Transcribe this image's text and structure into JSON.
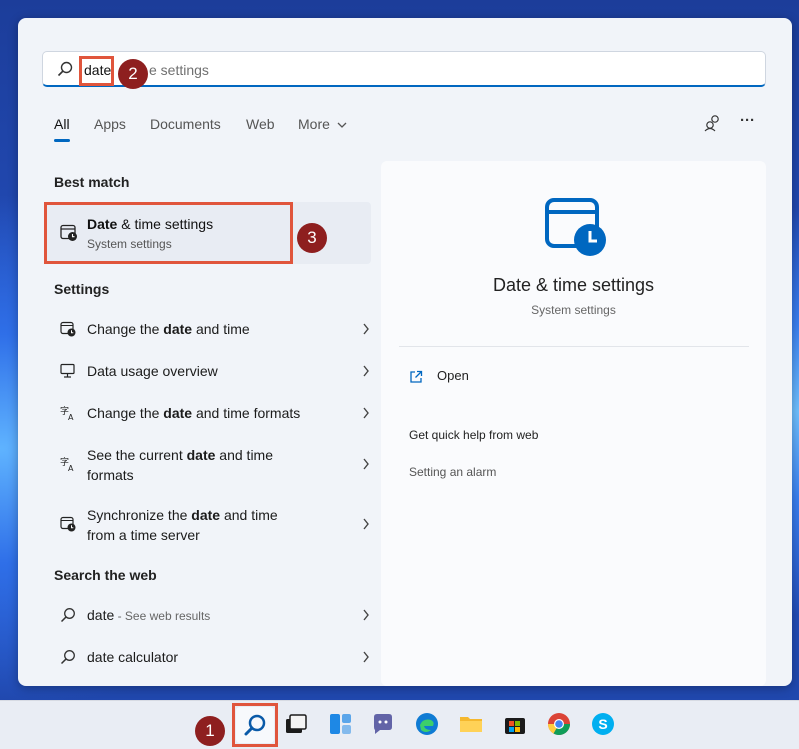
{
  "search": {
    "typed": "date",
    "placeholder_rest": "e settings"
  },
  "callouts": [
    "1",
    "2",
    "3"
  ],
  "tabs": [
    {
      "label": "All"
    },
    {
      "label": "Apps"
    },
    {
      "label": "Documents"
    },
    {
      "label": "Web"
    },
    {
      "label": "More"
    }
  ],
  "toolbar": {
    "more_options": "···"
  },
  "best_match": {
    "header": "Best match",
    "title_bold": "Date",
    "title_rest": " & time settings",
    "subtitle": "System settings"
  },
  "settings": {
    "header": "Settings",
    "items": [
      {
        "pre": "Change the ",
        "bold": "date",
        "post": " and time",
        "icon": "clock-calendar-icon"
      },
      {
        "pre": "Data usage overview",
        "bold": "",
        "post": "",
        "icon": "monitor-icon"
      },
      {
        "pre": "Change the ",
        "bold": "date",
        "post": " and time formats",
        "icon": "language-icon"
      },
      {
        "pre": "See the current ",
        "bold": "date",
        "post": " and time",
        "line2": "formats",
        "icon": "language-icon"
      },
      {
        "pre": "Synchronize the ",
        "bold": "date",
        "post": " and time",
        "line2": "from a time server",
        "icon": "clock-calendar-icon"
      }
    ]
  },
  "web": {
    "header": "Search the web",
    "items": [
      {
        "label": "date",
        "suffix": " - See web results"
      },
      {
        "label": "date calculator",
        "suffix": ""
      }
    ]
  },
  "preview": {
    "title": "Date & time settings",
    "subtitle": "System settings",
    "open": "Open",
    "help": "Get quick help from web",
    "link": "Setting an alarm"
  },
  "colors": {
    "accent": "#0067c0",
    "callout": "#8e1f1f",
    "highlight": "#e0553c"
  }
}
